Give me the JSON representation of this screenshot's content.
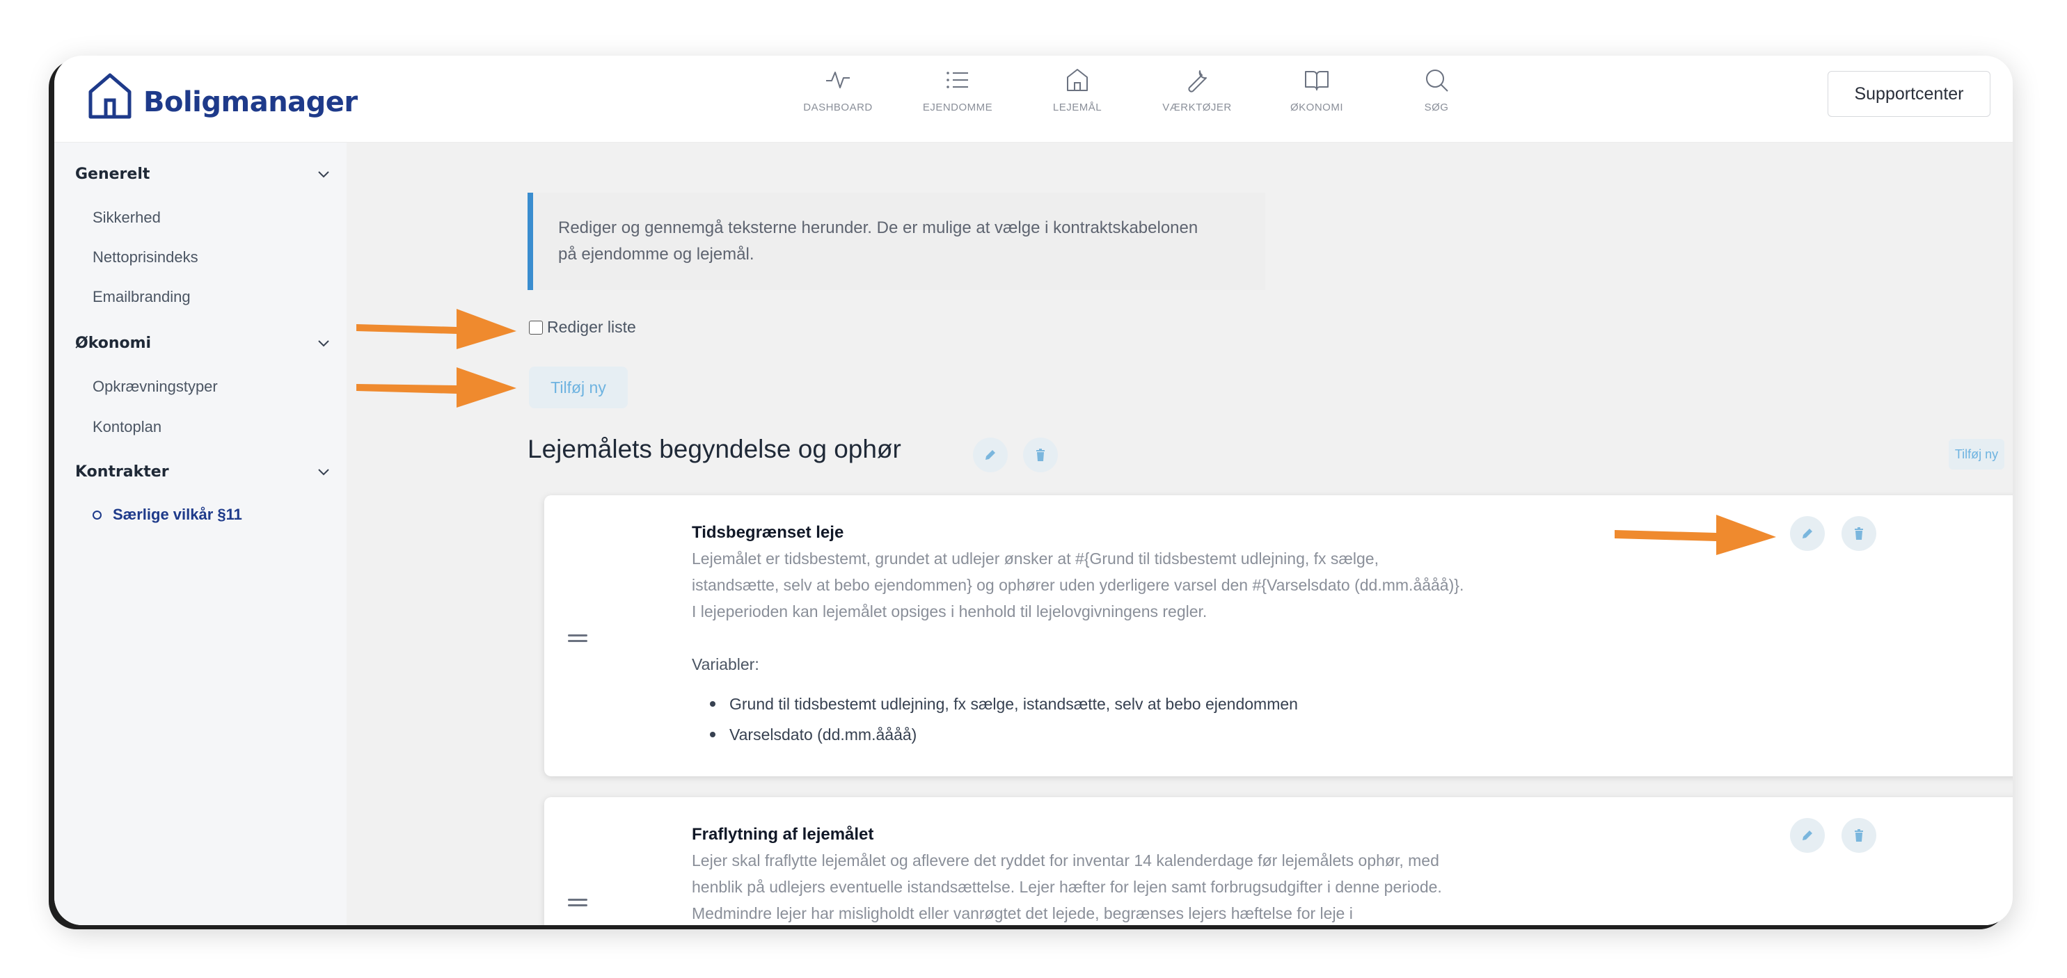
{
  "brand": {
    "name": "Boligmanager"
  },
  "nav": [
    {
      "label": "DASHBOARD",
      "icon": "activity-icon"
    },
    {
      "label": "EJENDOMME",
      "icon": "list-icon"
    },
    {
      "label": "LEJEMÅL",
      "icon": "home-icon"
    },
    {
      "label": "VÆRKTØJER",
      "icon": "wrench-icon"
    },
    {
      "label": "ØKONOMI",
      "icon": "book-open-icon"
    },
    {
      "label": "SØG",
      "icon": "search-icon"
    }
  ],
  "header": {
    "support_label": "Supportcenter"
  },
  "sidebar": {
    "groups": [
      {
        "label": "Generelt",
        "items": [
          "Sikkerhed",
          "Nettoprisindeks",
          "Emailbranding"
        ]
      },
      {
        "label": "Økonomi",
        "items": [
          "Opkrævningstyper",
          "Kontoplan"
        ]
      },
      {
        "label": "Kontrakter",
        "items": [
          "Særlige vilkår §11"
        ]
      }
    ]
  },
  "main": {
    "info_line1": "Rediger og gennemgå teksterne herunder. De er mulige at vælge i kontraktskabelonen",
    "info_line2": "på ejendomme og lejemål.",
    "edit_list_label": "Rediger liste",
    "add_new_label": "Tilføj ny",
    "section_title": "Lejemålets begyndelse og ophør",
    "section_add_label": "Tilføj ny",
    "cards": [
      {
        "title": "Tidsbegrænset leje",
        "lines": [
          "Lejemålet er tidsbestemt, grundet at udlejer ønsker at #{Grund til tidsbestemt udlejning, fx sælge,",
          "istandsætte, selv at bebo ejendommen} og ophører uden yderligere varsel den #{Varselsdato (dd.mm.åååå)}.",
          "I lejeperioden kan lejemålet opsiges i henhold til lejelovgivningens regler."
        ],
        "variables_label": "Variabler:",
        "variables": [
          "Grund til tidsbestemt udlejning, fx sælge, istandsætte, selv at bebo ejendommen",
          "Varselsdato (dd.mm.åååå)"
        ]
      },
      {
        "title": "Fraflytning af lejemålet",
        "lines": [
          "Lejer skal fraflytte lejemålet og aflevere det ryddet for inventar 14 kalenderdage før lejemålets ophør, med",
          "henblik på udlejers eventuelle istandsættelse. Lejer hæfter for lejen samt forbrugsudgifter i denne periode.",
          "Medmindre lejer har misligholdt eller vanrøgtet det lejede, begrænses lejers hæftelse for leje i"
        ]
      }
    ]
  },
  "colors": {
    "brand": "#1e3a8a",
    "accent_blue": "#3a8dcf",
    "soft_button": "#e6eef3",
    "arrow": "#ef8a2e"
  }
}
